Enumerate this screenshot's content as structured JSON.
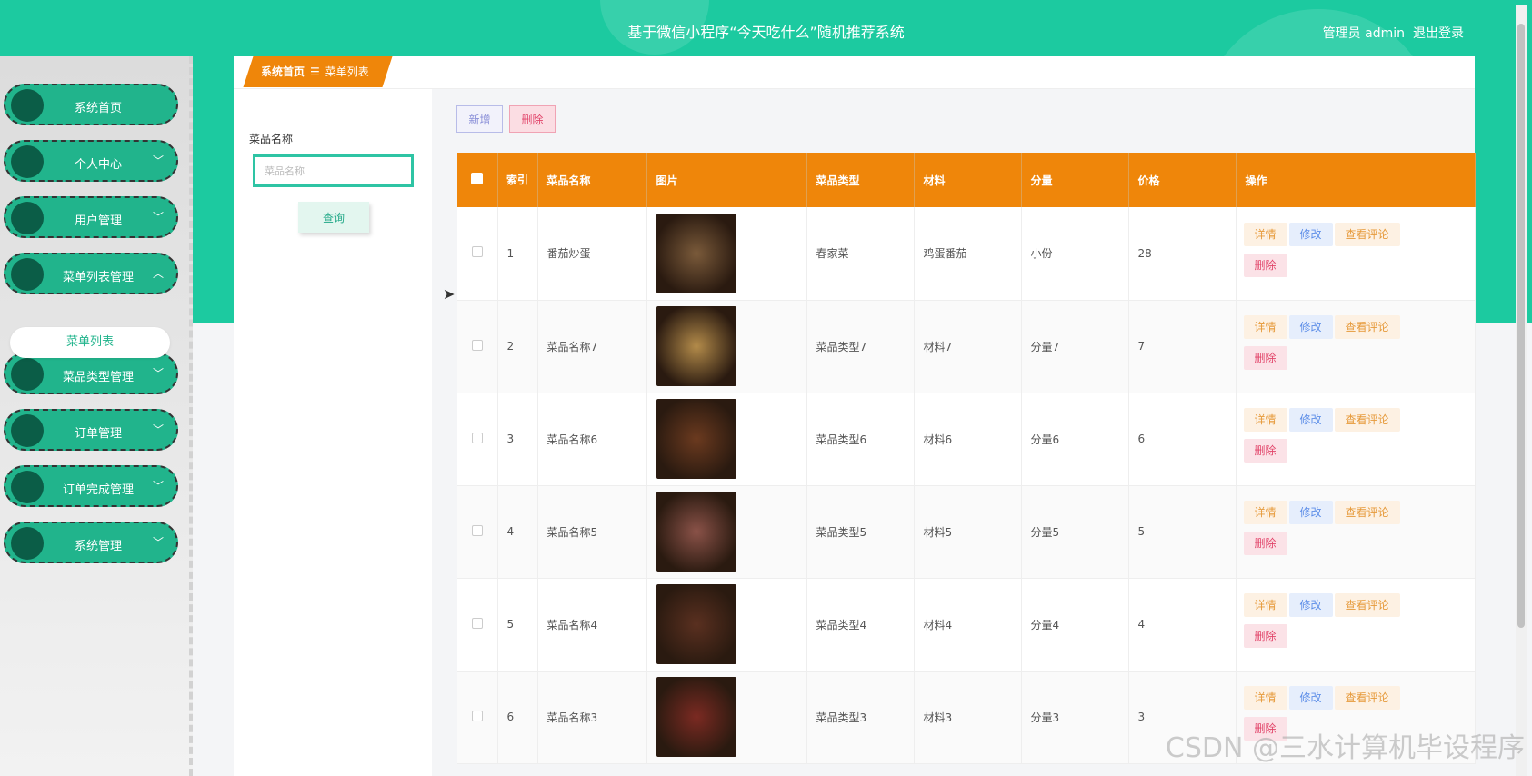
{
  "header": {
    "title": "基于微信小程序“今天吃什么”随机推荐系统",
    "user_label": "管理员 admin",
    "logout": "退出登录"
  },
  "sidebar": {
    "items": [
      {
        "label": "系统首页",
        "chevron": ""
      },
      {
        "label": "个人中心",
        "chevron": "﹀"
      },
      {
        "label": "用户管理",
        "chevron": "﹀"
      },
      {
        "label": "菜单列表管理",
        "chevron": "︿"
      },
      {
        "label": "菜品类型管理",
        "chevron": "﹀"
      },
      {
        "label": "订单管理",
        "chevron": "﹀"
      },
      {
        "label": "订单完成管理",
        "chevron": "﹀"
      },
      {
        "label": "系统管理",
        "chevron": "﹀"
      }
    ],
    "submenu_item": "菜单列表"
  },
  "breadcrumb": {
    "home": "系统首页",
    "sep": "☰",
    "current": "菜单列表"
  },
  "search": {
    "label": "菜品名称",
    "placeholder": "菜品名称",
    "button": "查询"
  },
  "toolbar": {
    "add": "新增",
    "delete": "删除"
  },
  "table": {
    "headers": {
      "index": "索引",
      "name": "菜品名称",
      "image": "图片",
      "type": "菜品类型",
      "material": "材料",
      "portion": "分量",
      "price": "价格",
      "actions": "操作"
    },
    "actions": {
      "detail": "详情",
      "edit": "修改",
      "review": "查看评论",
      "delete": "删除"
    },
    "rows": [
      {
        "index": "1",
        "name": "番茄炒蛋",
        "type": "春家菜",
        "material": "鸡蛋番茄",
        "portion": "小份",
        "price": "28",
        "img_color": "#7a5a3a"
      },
      {
        "index": "2",
        "name": "菜品名称7",
        "type": "菜品类型7",
        "material": "材料7",
        "portion": "分量7",
        "price": "7",
        "img_color": "#b38b4a"
      },
      {
        "index": "3",
        "name": "菜品名称6",
        "type": "菜品类型6",
        "material": "材料6",
        "portion": "分量6",
        "price": "6",
        "img_color": "#6b3a1f"
      },
      {
        "index": "4",
        "name": "菜品名称5",
        "type": "菜品类型5",
        "material": "材料5",
        "portion": "分量5",
        "price": "5",
        "img_color": "#8a5248"
      },
      {
        "index": "5",
        "name": "菜品名称4",
        "type": "菜品类型4",
        "material": "材料4",
        "portion": "分量4",
        "price": "4",
        "img_color": "#5a3020"
      },
      {
        "index": "6",
        "name": "菜品名称3",
        "type": "菜品类型3",
        "material": "材料3",
        "portion": "分量3",
        "price": "3",
        "img_color": "#7b2a22"
      }
    ]
  },
  "watermark": "CSDN @三水计算机毕设程序",
  "colors": {
    "header": "#1ccaa0",
    "sidebar_item": "#21b48c",
    "table_header": "#ef860a"
  }
}
